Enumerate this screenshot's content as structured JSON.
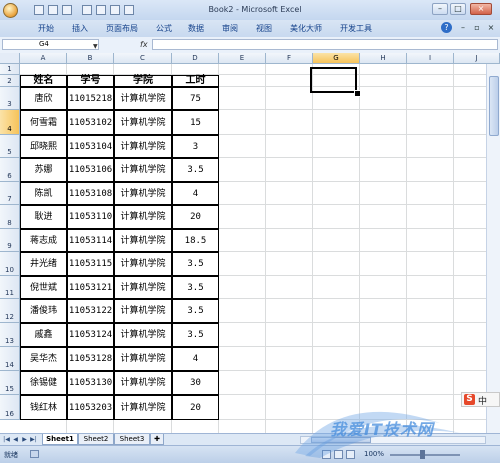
{
  "window": {
    "title": "Book2 - Microsoft Excel",
    "controls": [
      "–",
      "□",
      "×"
    ]
  },
  "ribbon": {
    "tabs": [
      "开始",
      "插入",
      "页面布局",
      "公式",
      "数据",
      "审阅",
      "视图",
      "美化大师",
      "开发工具"
    ]
  },
  "formula_bar": {
    "name_box": "G4",
    "fx": "fx",
    "value": ""
  },
  "columns": [
    "A",
    "B",
    "C",
    "D",
    "E",
    "F",
    "G",
    "H",
    "I",
    "J"
  ],
  "selected_column": "G",
  "rows": [
    "1",
    "2",
    "3",
    "4",
    "5",
    "6",
    "7",
    "8",
    "9",
    "10",
    "11",
    "12",
    "13",
    "14",
    "15",
    "16"
  ],
  "selected_row": "4",
  "table": {
    "headers": [
      "姓名",
      "学号",
      "学院",
      "工时"
    ],
    "rows": [
      [
        "唐欣",
        "11015218",
        "计算机学院",
        "75"
      ],
      [
        "何雪霜",
        "11053102",
        "计算机学院",
        "15"
      ],
      [
        "邱晓熙",
        "11053104",
        "计算机学院",
        "3"
      ],
      [
        "苏娜",
        "11053106",
        "计算机学院",
        "3.5"
      ],
      [
        "陈凯",
        "11053108",
        "计算机学院",
        "4"
      ],
      [
        "耿进",
        "11053110",
        "计算机学院",
        "20"
      ],
      [
        "蒋志成",
        "11053114",
        "计算机学院",
        "18.5"
      ],
      [
        "井光绪",
        "11053115",
        "计算机学院",
        "3.5"
      ],
      [
        "倪世斌",
        "11053121",
        "计算机学院",
        "3.5"
      ],
      [
        "潘俊玮",
        "11053122",
        "计算机学院",
        "3.5"
      ],
      [
        "戚鑫",
        "11053124",
        "计算机学院",
        "3.5"
      ],
      [
        "吴华杰",
        "11053128",
        "计算机学院",
        "4"
      ],
      [
        "徐锡健",
        "11053130",
        "计算机学院",
        "30"
      ],
      [
        "钱红林",
        "11053203",
        "计算机学院",
        "20"
      ]
    ]
  },
  "sheets": [
    {
      "name": "Sheet1",
      "active": true
    },
    {
      "name": "Sheet2",
      "active": false
    },
    {
      "name": "Sheet3",
      "active": false
    }
  ],
  "status": {
    "text": "就绪",
    "zoom": "100%"
  },
  "watermark": "我爱IT技术网",
  "ime": {
    "logo": "S",
    "lang": "中"
  }
}
